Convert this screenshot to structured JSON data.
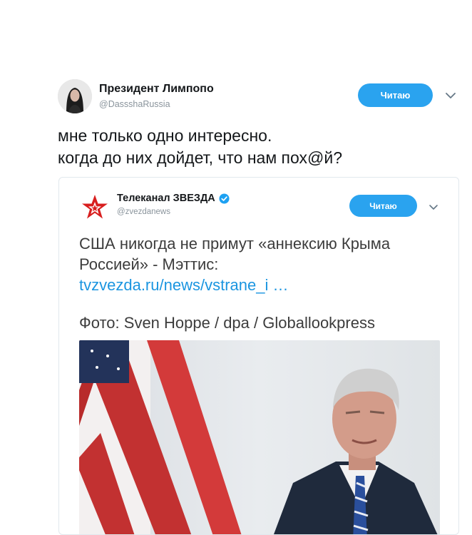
{
  "tweet": {
    "author": {
      "display_name": "Президент Лимпопо",
      "handle": "@DassshaRussia"
    },
    "follow_label": "Читаю",
    "text_lines": [
      "мне только одно интересно.",
      "когда до них дойдет, что нам пох@й?"
    ]
  },
  "quote": {
    "author": {
      "display_name": "Телеканал ЗВЕЗДА",
      "handle": "@zvezdanews"
    },
    "follow_label": "Читаю",
    "text_lines": [
      "США никогда не примут «аннексию Крыма",
      "Россией» - Мэттис:"
    ],
    "link": "tvzvezda.ru/news/vstrane_i …",
    "caption": "Фото: Sven Hoppe / dpa / Globallookpress"
  },
  "colors": {
    "accent": "#2aa3ef",
    "link": "#1b95e0",
    "verified": "#1da1f2",
    "zvezda_red": "#d81e1e"
  },
  "icons": {
    "more": "chevron-down-icon",
    "verified": "verified-badge-icon",
    "logo": "zvezda-star-logo"
  }
}
